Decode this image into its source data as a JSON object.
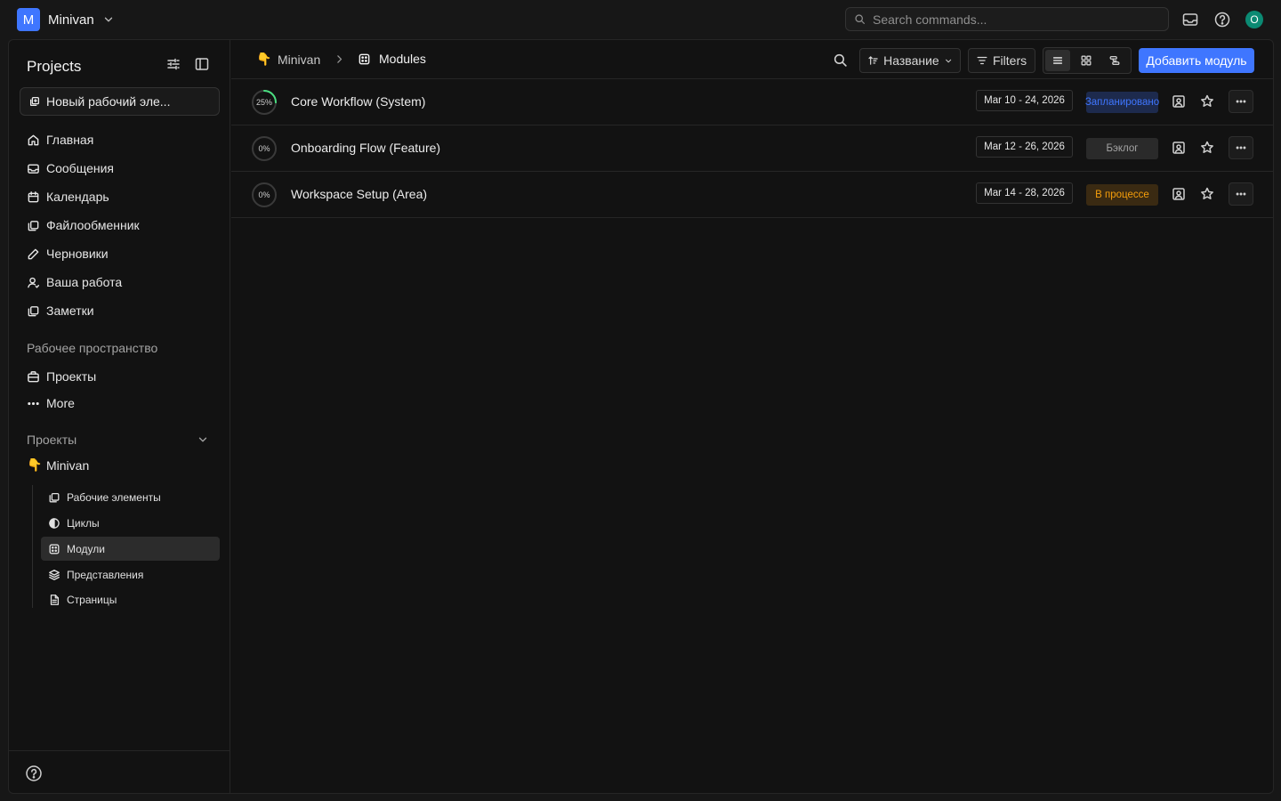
{
  "topbar": {
    "workspace_initial": "M",
    "workspace_name": "Minivan",
    "search_placeholder": "Search commands...",
    "avatar_initial": "O"
  },
  "sidebar": {
    "title": "Projects",
    "new_item_label": "Новый рабочий эле...",
    "nav": [
      "Главная",
      "Сообщения",
      "Календарь",
      "Файлообменник",
      "Черновики",
      "Ваша работа",
      "Заметки"
    ],
    "workspace_label": "Рабочее пространство",
    "workspace_items": [
      "Проекты",
      "More"
    ],
    "projects_label": "Проекты",
    "project_name": "Minivan",
    "project_subitems": [
      "Рабочие элементы",
      "Циклы",
      "Модули",
      "Представления",
      "Страницы"
    ],
    "active_subitem": "Модули"
  },
  "header": {
    "breadcrumb_project": "Minivan",
    "breadcrumb_current": "Modules",
    "sort_label": "Название",
    "filters_label": "Filters",
    "add_button": "Добавить модуль",
    "active_view": "list"
  },
  "modules": [
    {
      "progress_label": "25%",
      "progress": 0.25,
      "name": "Core Workflow (System)",
      "dates": "Mar 10 - 24, 2026",
      "status": "Запланировано",
      "status_color": "#3f76ff",
      "status_bg": "#1d2a4d"
    },
    {
      "progress_label": "0%",
      "progress": 0,
      "name": "Onboarding Flow (Feature)",
      "dates": "Mar 12 - 26, 2026",
      "status": "Бэклог",
      "status_color": "#a3a3a3",
      "status_bg": "#2a2a2a"
    },
    {
      "progress_label": "0%",
      "progress": 0,
      "name": "Workspace Setup (Area)",
      "dates": "Mar 14 - 28, 2026",
      "status": "В процессе",
      "status_color": "#f59e0b",
      "status_bg": "#3a2a12"
    }
  ],
  "colors": {
    "accent": "#3f76ff",
    "avatar": "#0b8a73"
  }
}
